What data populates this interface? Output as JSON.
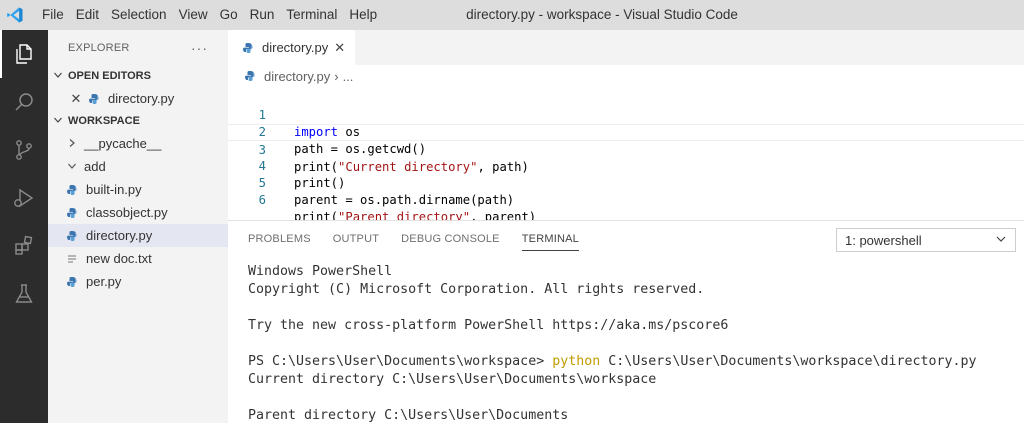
{
  "menubar": {
    "items": [
      "File",
      "Edit",
      "Selection",
      "View",
      "Go",
      "Run",
      "Terminal",
      "Help"
    ],
    "window_title": "directory.py - workspace - Visual Studio Code"
  },
  "activitybar": {
    "icons": [
      "explorer-icon",
      "search-icon",
      "source-control-icon",
      "run-debug-icon",
      "extensions-icon",
      "testing-icon"
    ]
  },
  "sidebar": {
    "title": "EXPLORER",
    "more": "···",
    "open_editors": {
      "label": "OPEN EDITORS",
      "items": [
        {
          "name": "directory.py"
        }
      ]
    },
    "workspace": {
      "label": "WORKSPACE",
      "items": [
        {
          "name": "__pycache__",
          "type": "folder",
          "expanded": false
        },
        {
          "name": "add",
          "type": "folder",
          "expanded": true
        },
        {
          "name": "built-in.py",
          "type": "python"
        },
        {
          "name": "classobject.py",
          "type": "python"
        },
        {
          "name": "directory.py",
          "type": "python",
          "selected": true
        },
        {
          "name": "new doc.txt",
          "type": "text"
        },
        {
          "name": "per.py",
          "type": "python"
        }
      ]
    }
  },
  "editor": {
    "tab_label": "directory.py",
    "breadcrumb": {
      "file": "directory.py",
      "rest": "..."
    },
    "lines": [
      {
        "num": "1",
        "text": "import os"
      },
      {
        "num": "2",
        "text": "path = os.getcwd()"
      },
      {
        "num": "3",
        "text": "print(\"Current directory\", path)"
      },
      {
        "num": "4",
        "text": "print()"
      },
      {
        "num": "5",
        "text": "parent = os.path.dirname(path)"
      },
      {
        "num": "6",
        "text": "print(\"Parent directory\", parent)"
      }
    ]
  },
  "panel": {
    "tabs": [
      "PROBLEMS",
      "OUTPUT",
      "DEBUG CONSOLE",
      "TERMINAL"
    ],
    "active_tab": "TERMINAL",
    "terminal_select": "1: powershell",
    "terminal_lines": [
      "Windows PowerShell",
      "Copyright (C) Microsoft Corporation. All rights reserved.",
      "",
      "Try the new cross-platform PowerShell https://aka.ms/pscore6",
      "",
      "",
      "Current directory C:\\Users\\User\\Documents\\workspace",
      "",
      "Parent directory C:\\Users\\User\\Documents"
    ],
    "prompt": "PS C:\\Users\\User\\Documents\\workspace> ",
    "command": "python",
    "command_arg": " C:\\Users\\User\\Documents\\workspace\\directory.py"
  },
  "colors": {
    "titlebar": "#dddddd",
    "activitybar": "#2c2c2c",
    "sidebar": "#f3f3f3",
    "keyword": "#0000ff",
    "string": "#a31515",
    "line_number": "#237893",
    "command": "#c19c00"
  }
}
